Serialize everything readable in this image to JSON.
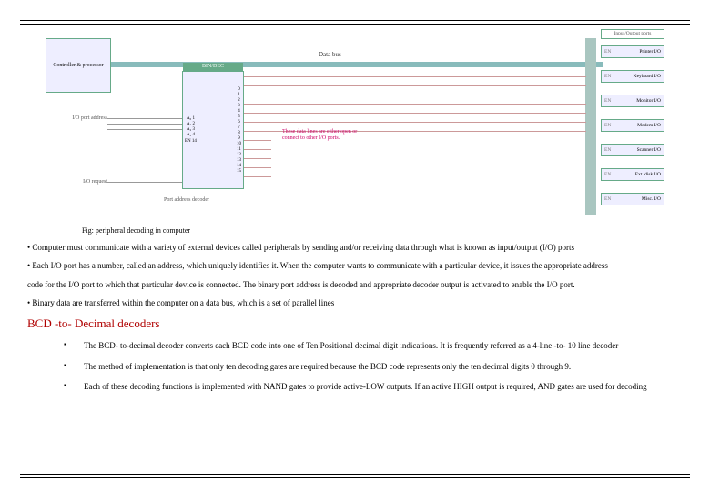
{
  "diagram": {
    "cpu": "Controller & processor",
    "databus": "Data bus",
    "bindec_title": "BIN/DEC",
    "bindec_left_pins": [
      "A₀",
      "A₁",
      "A₂",
      "A₃",
      " ",
      "EN"
    ],
    "bindec_left_nums": [
      "1",
      "2",
      "3",
      "4",
      " ",
      "14"
    ],
    "bindec_right_nums": [
      "0",
      "1",
      "2",
      "3",
      "4",
      "5",
      "6",
      "7",
      "8",
      "9",
      "10",
      "11",
      "12",
      "13",
      "14",
      "15"
    ],
    "port_addr": "I/O port address",
    "io_request": "I/O request",
    "port_decoder": "Port address decoder",
    "pink_note": "These data lines are either open or connect to other I/O ports.",
    "io_header": "Input/Output ports",
    "devices": [
      {
        "name": "Printer I/O",
        "en": "EN"
      },
      {
        "name": "Keyboard I/O",
        "en": "EN"
      },
      {
        "name": "Monitor I/O",
        "en": "EN"
      },
      {
        "name": "Modem I/O",
        "en": "EN"
      },
      {
        "name": "Scanner I/O",
        "en": "EN"
      },
      {
        "name": "Ext. disk I/O",
        "en": "EN"
      },
      {
        "name": "Misc. I/O",
        "en": "EN"
      }
    ]
  },
  "caption": "Fig: peripheral decoding in computer",
  "para1": "• Computer must communicate with a variety of external devices called peripherals by sending and/or  receiving data through what is known as input/output (I/O) ports",
  "para2a": "• Each I/O port has a number, called an address, which uniquely identifies it. When the computer wants  to communicate with a particular device, it issues the appropriate address",
  "para2b": "code for the I/O port to which that particular device is connected. The binary port address is decoded and appropriate decoder  output is activated to enable the I/O port.",
  "para3": "• Binary data are transferred within the computer on a data bus, which is a set of parallel lines",
  "heading": "BCD -to- Decimal decoders",
  "b1": "The BCD- to-decimal decoder converts each BCD code into one of Ten Positional decimal digit indications. It is frequently referred as a 4-line -to- 10 line decoder",
  "b2": "The method of implementation is that only ten decoding gates are required because the BCD code represents only the ten decimal digits 0 through 9.",
  "b3": "Each of these decoding functions is implemented with NAND gates to provide active-LOW outputs. If an active HIGH output is required, AND gates are used for decoding"
}
